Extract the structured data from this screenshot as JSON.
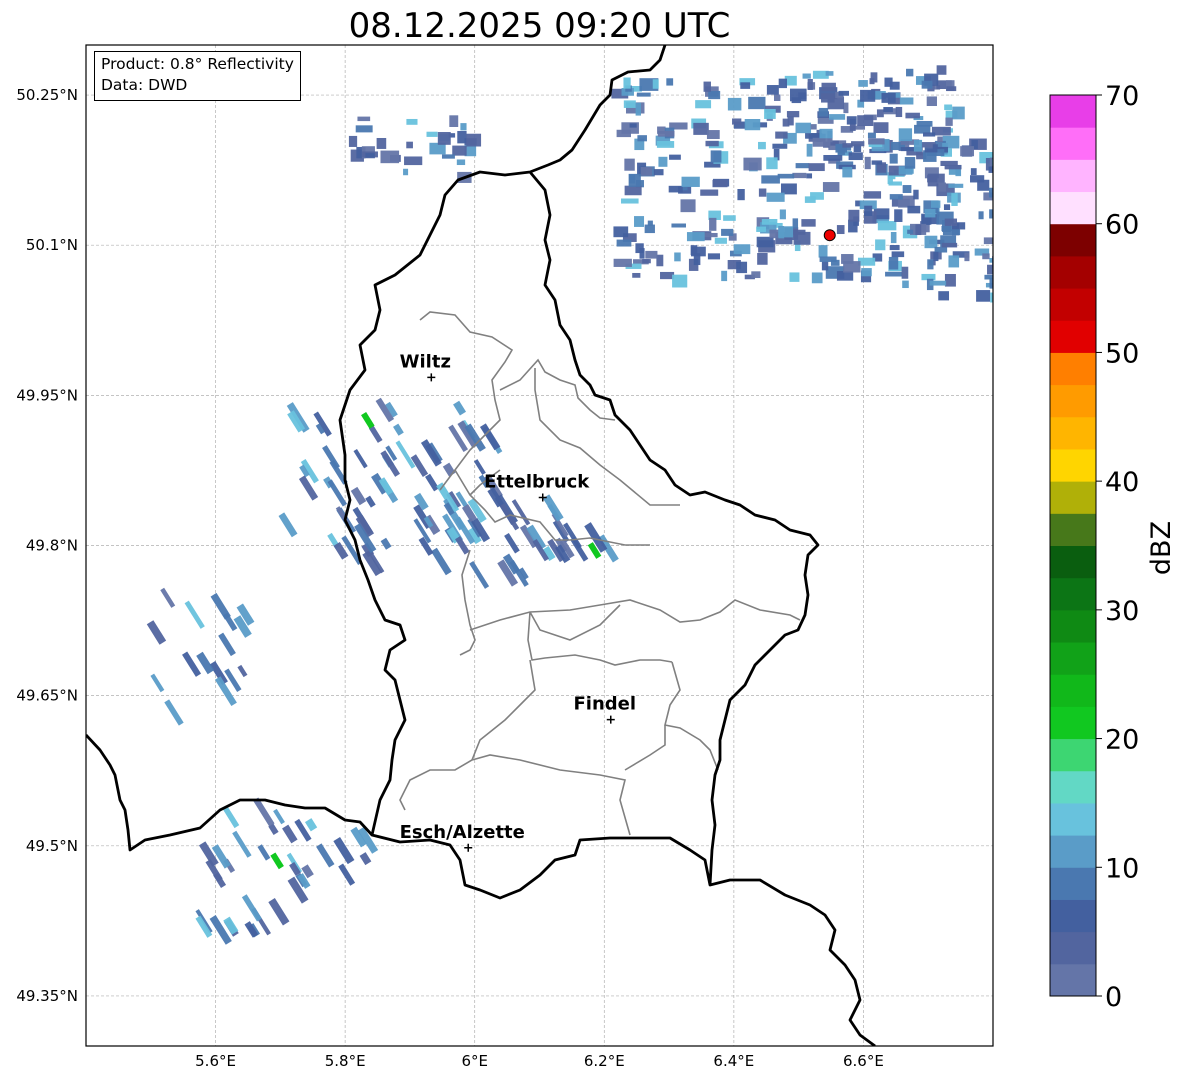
{
  "title": "08.12.2025 09:20 UTC",
  "info_box": {
    "product": "Product: 0.8° Reflectivity",
    "data": "Data: DWD"
  },
  "map": {
    "lon_range": [
      5.4,
      6.8
    ],
    "lat_range": [
      49.3,
      50.3
    ],
    "lon_ticks": [
      {
        "value": 5.6,
        "label": "5.6°E"
      },
      {
        "value": 5.8,
        "label": "5.8°E"
      },
      {
        "value": 6.0,
        "label": "6°E"
      },
      {
        "value": 6.2,
        "label": "6.2°E"
      },
      {
        "value": 6.4,
        "label": "6.4°E"
      },
      {
        "value": 6.6,
        "label": "6.6°E"
      }
    ],
    "lat_ticks": [
      {
        "value": 50.25,
        "label": "50.25°N"
      },
      {
        "value": 50.1,
        "label": "50.1°N"
      },
      {
        "value": 49.95,
        "label": "49.95°N"
      },
      {
        "value": 49.8,
        "label": "49.8°N"
      },
      {
        "value": 49.65,
        "label": "49.65°N"
      },
      {
        "value": 49.5,
        "label": "49.5°N"
      },
      {
        "value": 49.35,
        "label": "49.35°N"
      }
    ],
    "cities": [
      {
        "name": "Wiltz",
        "lon": 5.933,
        "lat": 49.968
      },
      {
        "name": "Ettelbruck",
        "lon": 6.105,
        "lat": 49.848
      },
      {
        "name": "Findel",
        "lon": 6.21,
        "lat": 49.626
      },
      {
        "name": "Esch/Alzette",
        "lon": 5.99,
        "lat": 49.498
      }
    ],
    "radar_site": {
      "lon": 6.548,
      "lat": 50.11
    }
  },
  "colorbar": {
    "label": "dBZ",
    "min": 0,
    "max": 70,
    "ticks": [
      0,
      10,
      20,
      30,
      40,
      50,
      60,
      70
    ],
    "colors": [
      "#6475a8",
      "#52659f",
      "#43609f",
      "#4a78b0",
      "#5a9cc8",
      "#68c2dd",
      "#62d8c5",
      "#3dd672",
      "#11c820",
      "#11b81a",
      "#11a218",
      "#0f8a14",
      "#0c7515",
      "#0a5e0f",
      "#47781a",
      "#b0b008",
      "#ffd500",
      "#ffb500",
      "#ff9b00",
      "#ff7f00",
      "#e10000",
      "#c20000",
      "#a40000",
      "#7d0000",
      "#ffe0ff",
      "#ffb4ff",
      "#ff6ef8",
      "#e83ee8"
    ]
  },
  "echo_clusters": [
    {
      "lon": 5.87,
      "lat": 49.86,
      "dlon": 0.16,
      "dlat": 0.08,
      "n": 70
    },
    {
      "lon": 6.06,
      "lat": 49.81,
      "dlon": 0.08,
      "dlat": 0.04,
      "n": 22
    },
    {
      "lon": 6.17,
      "lat": 49.81,
      "dlon": 0.05,
      "dlat": 0.03,
      "n": 10
    },
    {
      "lon": 5.58,
      "lat": 49.69,
      "dlon": 0.08,
      "dlat": 0.06,
      "n": 16
    },
    {
      "lon": 5.66,
      "lat": 49.48,
      "dlon": 0.08,
      "dlat": 0.07,
      "n": 26
    },
    {
      "lon": 5.78,
      "lat": 49.5,
      "dlon": 0.06,
      "dlat": 0.03,
      "n": 10
    },
    {
      "lon": 6.47,
      "lat": 50.17,
      "dlon": 0.26,
      "dlat": 0.1,
      "n": 260
    },
    {
      "lon": 6.72,
      "lat": 50.13,
      "dlon": 0.08,
      "dlat": 0.08,
      "n": 80
    },
    {
      "lon": 6.62,
      "lat": 50.23,
      "dlon": 0.12,
      "dlat": 0.05,
      "n": 60
    },
    {
      "lon": 5.9,
      "lat": 50.2,
      "dlon": 0.1,
      "dlat": 0.03,
      "n": 30
    }
  ]
}
